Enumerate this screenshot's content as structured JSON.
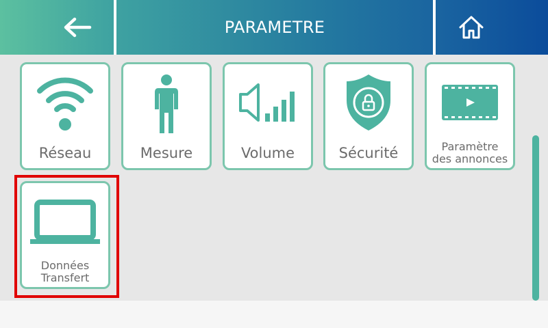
{
  "header": {
    "title": "PARAMETRE",
    "back_icon": "arrow-left-icon",
    "home_icon": "home-icon"
  },
  "tiles": [
    {
      "label": "Réseau",
      "icon": "wifi-icon"
    },
    {
      "label": "Mesure",
      "icon": "person-icon"
    },
    {
      "label": "Volume",
      "icon": "volume-icon"
    },
    {
      "label": "Sécurité",
      "icon": "shield-lock-icon"
    },
    {
      "label_line1": "Paramètre",
      "label_line2": "des annonces",
      "icon": "video-icon"
    },
    {
      "label_line1": "Données",
      "label_line2": "Transfert",
      "icon": "laptop-icon"
    }
  ],
  "colors": {
    "accent": "#4db3a0",
    "tile_border": "#7cc6ad",
    "label": "#6b6b6b",
    "highlight": "#e00000",
    "header_start": "#5cc0a0",
    "header_end": "#0b4c9b"
  }
}
